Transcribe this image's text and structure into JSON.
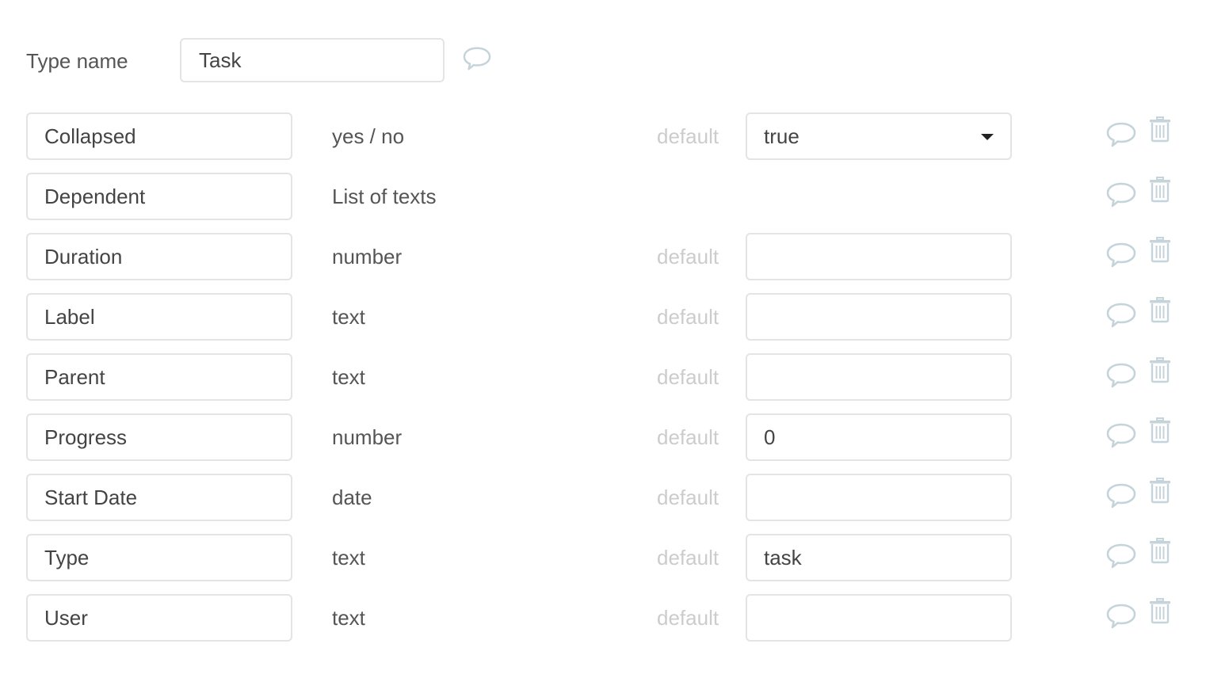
{
  "type_name": {
    "label": "Type name",
    "value": "Task",
    "comment_icon": "comment-icon"
  },
  "default_label": "default",
  "colors": {
    "icon": "#c5d3da",
    "border": "#e4e4e4",
    "muted_text": "#cccccc",
    "text": "#444444"
  },
  "fields": [
    {
      "name": "Collapsed",
      "type": "yes / no",
      "has_default": true,
      "default_kind": "select",
      "default_value": "true",
      "icons": [
        "comment-icon",
        "trash-icon"
      ]
    },
    {
      "name": "Dependent",
      "type": "List of texts",
      "has_default": false,
      "default_kind": "none",
      "default_value": "",
      "icons": [
        "comment-icon",
        "trash-icon"
      ]
    },
    {
      "name": "Duration",
      "type": "number",
      "has_default": true,
      "default_kind": "input",
      "default_value": "",
      "icons": [
        "comment-icon",
        "trash-icon"
      ]
    },
    {
      "name": "Label",
      "type": "text",
      "has_default": true,
      "default_kind": "input",
      "default_value": "",
      "icons": [
        "comment-icon",
        "trash-icon"
      ]
    },
    {
      "name": "Parent",
      "type": "text",
      "has_default": true,
      "default_kind": "input",
      "default_value": "",
      "icons": [
        "comment-icon",
        "trash-icon"
      ]
    },
    {
      "name": "Progress",
      "type": "number",
      "has_default": true,
      "default_kind": "input",
      "default_value": "0",
      "icons": [
        "comment-icon",
        "trash-icon"
      ]
    },
    {
      "name": "Start Date",
      "type": "date",
      "has_default": true,
      "default_kind": "input",
      "default_value": "",
      "icons": [
        "comment-icon",
        "trash-icon"
      ]
    },
    {
      "name": "Type",
      "type": "text",
      "has_default": true,
      "default_kind": "input",
      "default_value": "task",
      "icons": [
        "comment-icon",
        "trash-icon"
      ]
    },
    {
      "name": "User",
      "type": "text",
      "has_default": true,
      "default_kind": "input",
      "default_value": "",
      "icons": [
        "comment-icon",
        "trash-icon"
      ]
    }
  ]
}
